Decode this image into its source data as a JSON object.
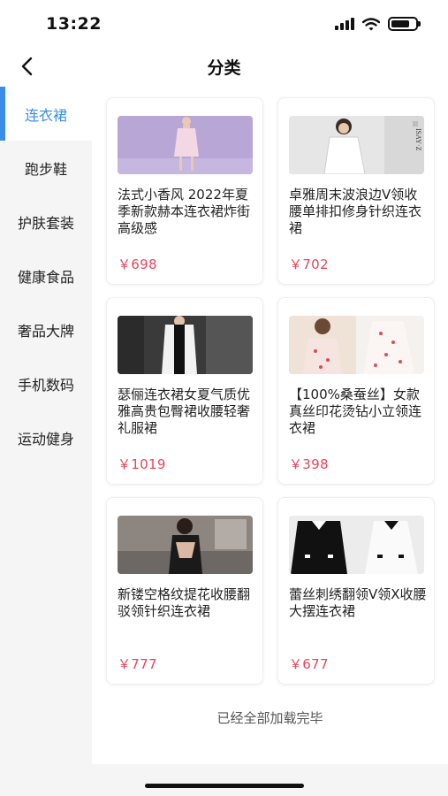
{
  "status_bar": {
    "time": "13:22"
  },
  "nav": {
    "title": "分类"
  },
  "sidebar": {
    "items": [
      {
        "label": "连衣裙",
        "active": true
      },
      {
        "label": "跑步鞋",
        "active": false
      },
      {
        "label": "护肤套装",
        "active": false
      },
      {
        "label": "健康食品",
        "active": false
      },
      {
        "label": "奢品大牌",
        "active": false
      },
      {
        "label": "手机数码",
        "active": false
      },
      {
        "label": "运动健身",
        "active": false
      }
    ]
  },
  "products": [
    {
      "title": "法式小香风 2022年夏季新款赫本连衣裙炸街高级感",
      "price": "￥698"
    },
    {
      "title": "卓雅周末波浪边V领收腰单排扣修身针织连衣裙",
      "price": "￥702",
      "image_brand_text": "ISAY·Z"
    },
    {
      "title": "瑟俪连衣裙女夏气质优雅高贵包臀裙收腰轻奢礼服裙",
      "price": "￥1019"
    },
    {
      "title": "【100%桑蚕丝】女款真丝印花烫钻小立领连衣裙",
      "price": "￥398"
    },
    {
      "title": "新镂空格纹提花收腰翻驳领针织连衣裙",
      "price": "￥777"
    },
    {
      "title": "蕾丝刺绣翻领V领X收腰大摆连衣裙",
      "price": "￥677"
    }
  ],
  "footer": {
    "load_complete": "已经全部加载完毕"
  },
  "colors": {
    "accent": "#3a8de8",
    "price": "#e8445a"
  }
}
